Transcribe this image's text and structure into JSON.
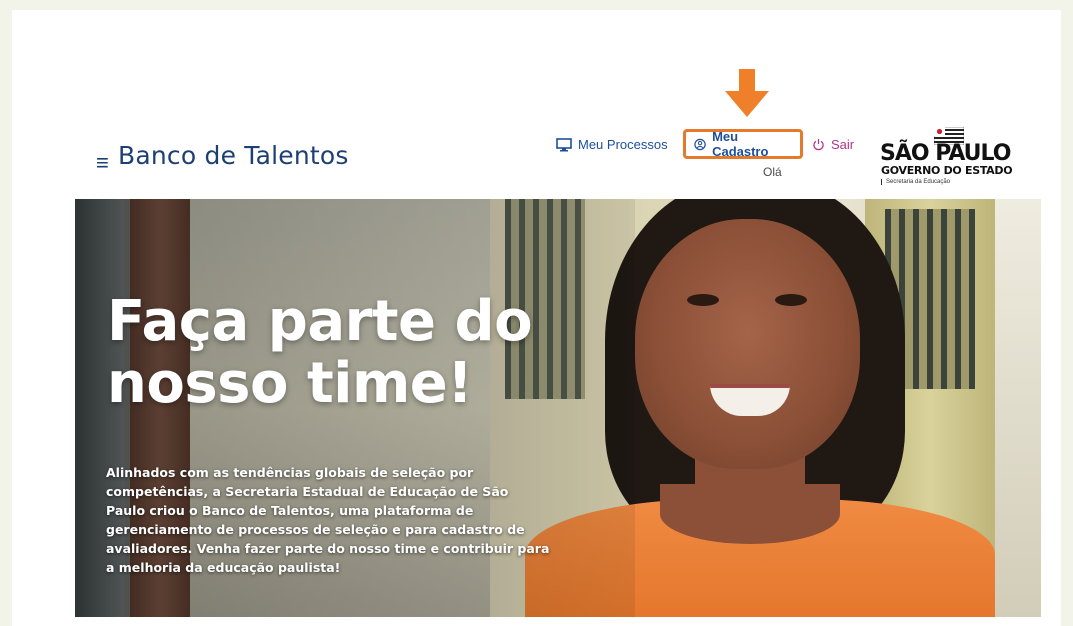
{
  "header": {
    "menu_icon": "hamburger-icon",
    "brand": "Banco de Talentos",
    "nav": {
      "processos": {
        "label": "Meu Processos",
        "icon": "monitor-icon"
      },
      "cadastro": {
        "label": "Meu Cadastro",
        "icon": "user-circle-icon",
        "highlight_color": "#e57a2c"
      },
      "sair": {
        "label": "Sair",
        "icon": "power-icon"
      }
    },
    "greeting": "Olá"
  },
  "gov_logo": {
    "line1": "SÃO PAULO",
    "line2": "GOVERNO DO ESTADO",
    "line3": "Secretaria da Educação"
  },
  "annotation": {
    "icon": "arrow-down-icon",
    "color": "#f07f2a"
  },
  "hero": {
    "title": "Faça parte do nosso time!",
    "text": "Alinhados com as tendências globais de seleção por competências, a Secretaria Estadual de Educação de São Paulo criou o Banco de Talentos, uma plataforma de gerenciamento de processos de seleção e para cadastro de avaliadores. Venha fazer parte do nosso time e contribuir para a melhoria da educação paulista!"
  },
  "colors": {
    "brand": "#1e3f73",
    "link": "#1e4f9a",
    "sair": "#b2338b",
    "accent": "#e57a2c"
  }
}
